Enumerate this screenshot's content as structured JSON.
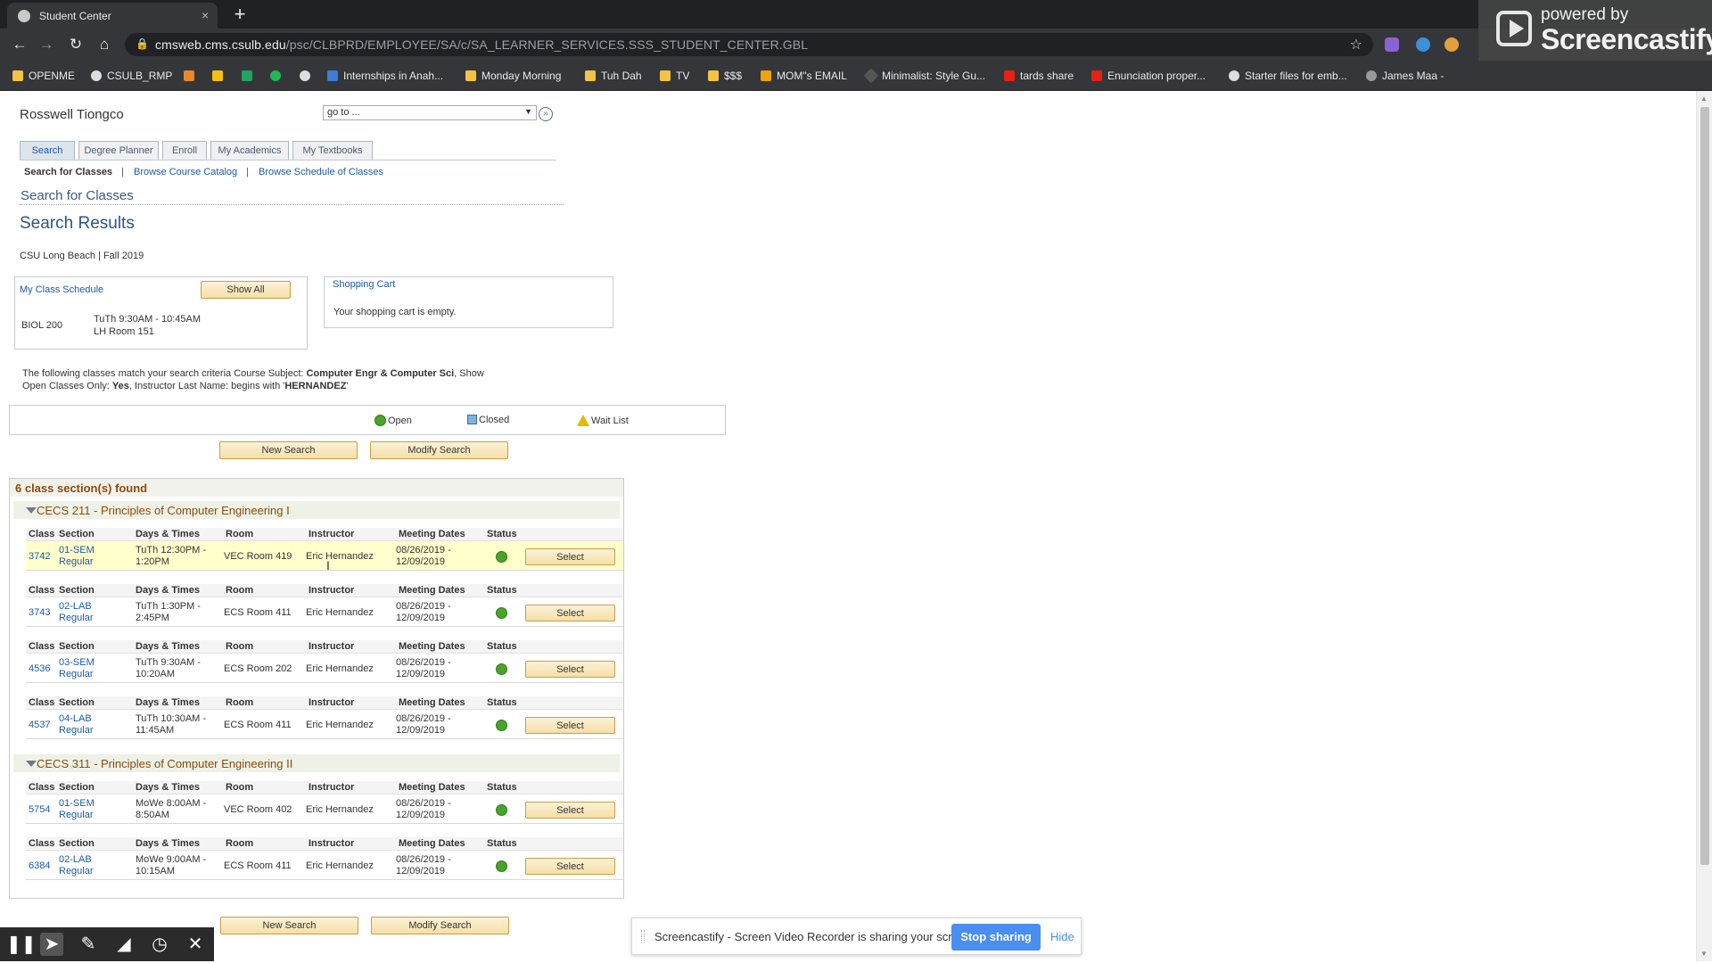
{
  "browser": {
    "tab_title": "Student Center",
    "url_host": "cmsweb.cms.csulb.edu",
    "url_path": "/psc/CLBPRD/EMPLOYEE/SA/c/SA_LEARNER_SERVICES.SSS_STUDENT_CENTER.GBL",
    "bookmarks": [
      "OPENME",
      "CSULB_RMP",
      "Internships in Anah...",
      "Monday Morning",
      "Tuh Dah",
      "TV",
      "$$$",
      "MOM\"s EMAIL",
      "Minimalist: Style Gu...",
      "tards share",
      "Enunciation proper...",
      "Starter files for emb...",
      "James Maa -"
    ]
  },
  "watermark": {
    "line1": "powered by",
    "line2": "Screencastify"
  },
  "header": {
    "user_name": "Rosswell Tiongco",
    "goto_value": "go to ...",
    "tabs": [
      "Search",
      "Degree Planner",
      "Enroll",
      "My Academics",
      "My Textbooks"
    ],
    "subnav": {
      "current": "Search for Classes",
      "sep": "|",
      "link1": "Browse Course Catalog",
      "link2": "Browse Schedule of Classes"
    }
  },
  "main": {
    "section_title": "Search for Classes",
    "results_title": "Search Results",
    "institution_term": "CSU Long Beach | Fall 2019",
    "schedule": {
      "title": "My Class Schedule",
      "show_all": "Show All",
      "course": "BIOL 200",
      "time": "TuTh 9:30AM - 10:45AM",
      "room": "LH  Room 151"
    },
    "cart": {
      "title": "Shopping Cart",
      "empty_msg": "Your shopping cart is empty."
    },
    "criteria": {
      "prefix": "The following classes match your search criteria Course Subject: ",
      "subject": "Computer Engr & Computer Sci",
      "mid1": ",  Show Open Classes Only: ",
      "open_only": "Yes",
      "mid2": ",  Instructor Last Name: begins with '",
      "instructor": "HERNANDEZ",
      "suffix": "'"
    },
    "legend": {
      "open": "Open",
      "closed": "Closed",
      "waitlist": "Wait List"
    },
    "buttons": {
      "new_search": "New Search",
      "modify_search": "Modify Search"
    },
    "found_text": "6 class section(s) found",
    "headers": {
      "class": "Class",
      "section": "Section",
      "days": "Days & Times",
      "room": "Room",
      "instructor": "Instructor",
      "dates": "Meeting Dates",
      "status": "Status"
    },
    "select_label": "Select",
    "courses": [
      {
        "title": "CECS 211 - Principles of Computer Engineering I",
        "sections": [
          {
            "class": "3742",
            "sec1": "01-SEM",
            "sec2": "Regular",
            "days1": "TuTh 12:30PM -",
            "days2": "1:20PM",
            "room": "VEC  Room 419",
            "instructor": "Eric Hernandez",
            "date1": "08/26/2019 -",
            "date2": "12/09/2019",
            "status": "Open"
          },
          {
            "class": "3743",
            "sec1": "02-LAB",
            "sec2": "Regular",
            "days1": "TuTh 1:30PM -",
            "days2": "2:45PM",
            "room": "ECS  Room 411",
            "instructor": "Eric Hernandez",
            "date1": "08/26/2019 -",
            "date2": "12/09/2019",
            "status": "Open"
          },
          {
            "class": "4536",
            "sec1": "03-SEM",
            "sec2": "Regular",
            "days1": "TuTh 9:30AM -",
            "days2": "10:20AM",
            "room": "ECS  Room 202",
            "instructor": "Eric Hernandez",
            "date1": "08/26/2019 -",
            "date2": "12/09/2019",
            "status": "Open"
          },
          {
            "class": "4537",
            "sec1": "04-LAB",
            "sec2": "Regular",
            "days1": "TuTh 10:30AM -",
            "days2": "11:45AM",
            "room": "ECS  Room 411",
            "instructor": "Eric Hernandez",
            "date1": "08/26/2019 -",
            "date2": "12/09/2019",
            "status": "Open"
          }
        ]
      },
      {
        "title": "CECS 311 - Principles of Computer Engineering II",
        "sections": [
          {
            "class": "5754",
            "sec1": "01-SEM",
            "sec2": "Regular",
            "days1": "MoWe 8:00AM -",
            "days2": "8:50AM",
            "room": "VEC  Room 402",
            "instructor": "Eric Hernandez",
            "date1": "08/26/2019 -",
            "date2": "12/09/2019",
            "status": "Open"
          },
          {
            "class": "6384",
            "sec1": "02-LAB",
            "sec2": "Regular",
            "days1": "MoWe 9:00AM -",
            "days2": "10:15AM",
            "room": "ECS  Room 411",
            "instructor": "Eric Hernandez",
            "date1": "08/26/2019 -",
            "date2": "12/09/2019",
            "status": "Open"
          }
        ]
      }
    ]
  },
  "share_bar": {
    "message": "Screencastify - Screen Video Recorder is sharing your screen.",
    "stop": "Stop sharing",
    "hide": "Hide"
  },
  "colors": {
    "open_status": "#4aa32b",
    "button_bg": "#f6dfa6",
    "link": "#1d5aa6",
    "course_title": "#8a4b0f"
  }
}
